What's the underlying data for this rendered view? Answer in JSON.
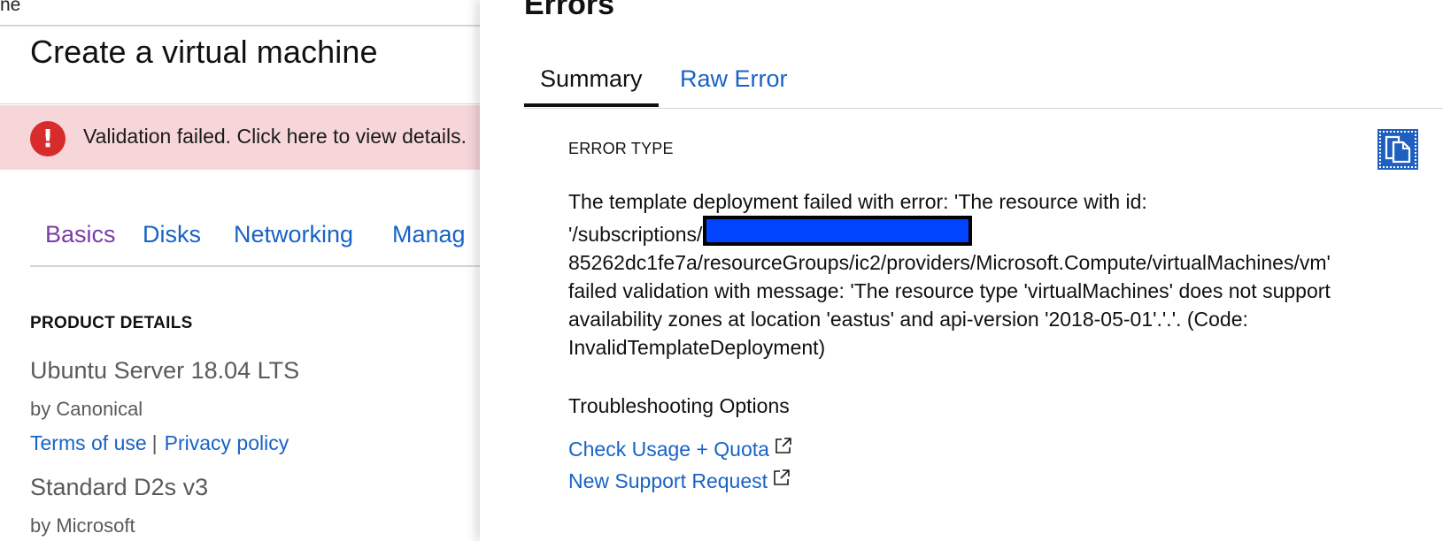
{
  "breadcrumb": {
    "fragment": "ne"
  },
  "left": {
    "title": "Create a virtual machine",
    "banner": {
      "icon": "error-icon",
      "text": "Validation failed. Click here to view details."
    },
    "tabs": [
      {
        "label": "Basics",
        "active": true
      },
      {
        "label": "Disks",
        "active": false
      },
      {
        "label": "Networking",
        "active": false
      },
      {
        "label": "Manag",
        "active": false
      }
    ],
    "section_heading": "PRODUCT DETAILS",
    "product": {
      "name": "Ubuntu Server 18.04 LTS",
      "publisher": "by Canonical",
      "terms_link": "Terms of use",
      "separator": "|",
      "privacy_link": "Privacy policy"
    },
    "size": {
      "name": "Standard D2s v3",
      "publisher": "by Microsoft"
    }
  },
  "errors": {
    "title": "Errors",
    "tabs": {
      "summary": "Summary",
      "raw": "Raw Error"
    },
    "error_type_label": "ERROR TYPE",
    "copy_icon": "copy-icon",
    "message_lines": [
      "The template deployment failed with error: 'The resource with id:",
      "'/subscriptions/",
      "85262dc1fe7a/resourceGroups/ic2/providers/Microsoft.Compute/virtualMachines/vm'",
      "failed validation with message: 'The resource type 'virtualMachines' does not support",
      "availability zones at location 'eastus' and api-version '2018-05-01'.'.'. (Code:",
      "InvalidTemplateDeployment)"
    ],
    "troubleshooting_heading": "Troubleshooting Options",
    "links": [
      {
        "label": "Check Usage + Quota",
        "icon": "external-link-icon"
      },
      {
        "label": "New Support Request",
        "icon": "external-link-icon"
      }
    ]
  },
  "colors": {
    "link": "#1863c5",
    "active_tab": "#7a3da9",
    "banner_bg": "#f7d6da",
    "error_red": "#d82b2b",
    "copy_button": "#1e5fbf",
    "redaction": "#0044ff"
  }
}
